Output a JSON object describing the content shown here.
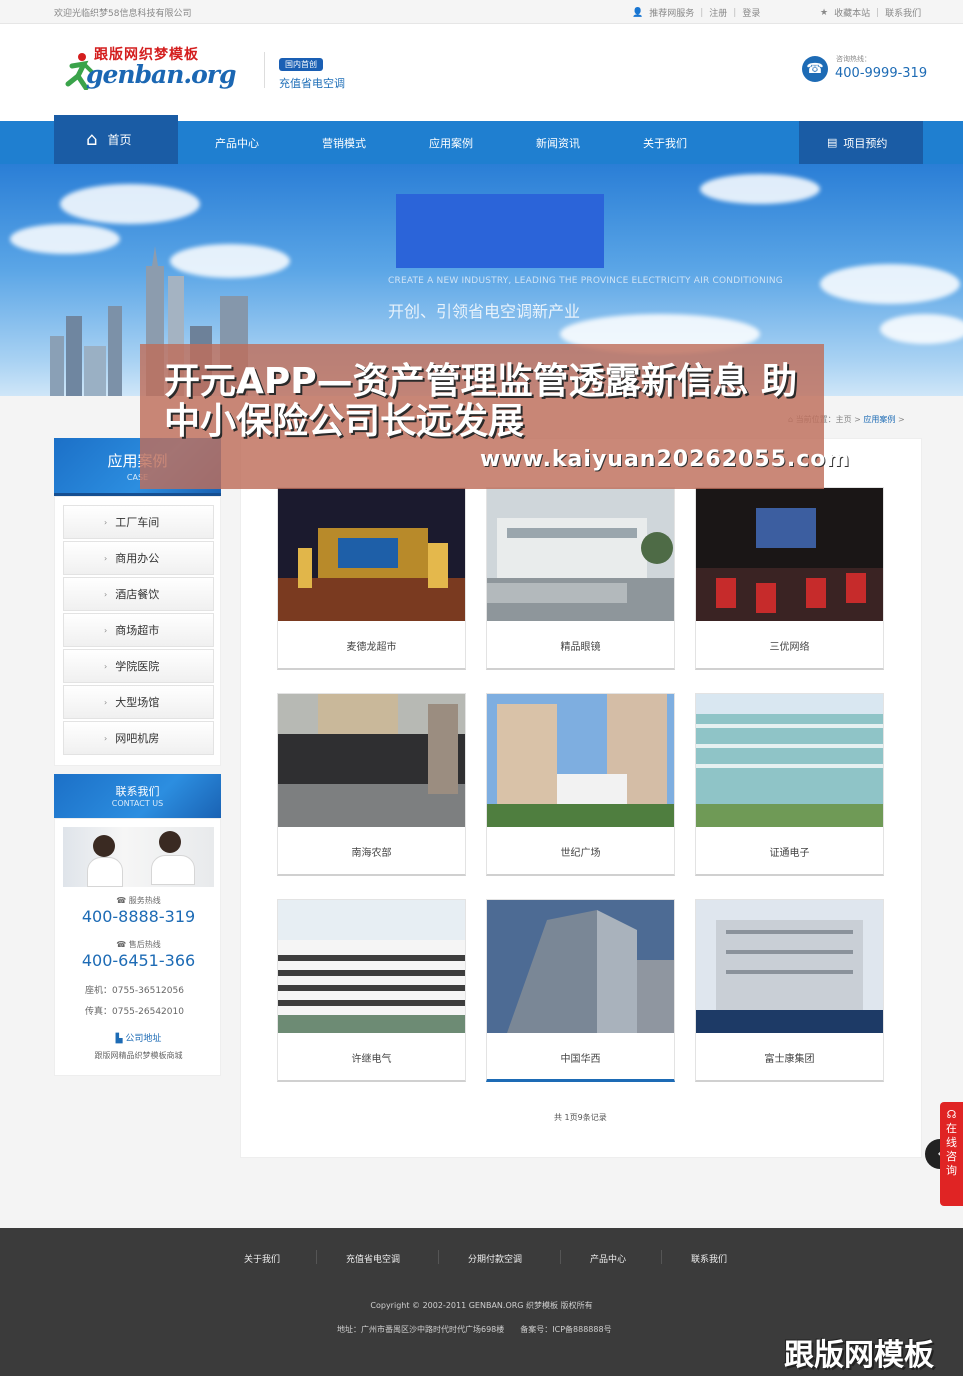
{
  "topbar": {
    "welcome": "欢迎光临织梦58信息科技有限公司",
    "links": [
      "推荐网服务",
      "注册",
      "登录"
    ],
    "right_links": [
      "收藏本站",
      "联系我们"
    ]
  },
  "header": {
    "logo_cn": "跟版网织梦模板",
    "logo_en": "genban.org",
    "badge": "国内首创",
    "slogan": "充值省电空调",
    "hotline_label": "咨询热线：",
    "hotline": "400-9999-319"
  },
  "nav": {
    "home": "首页",
    "items": [
      "产品中心",
      "营销模式",
      "应用案例",
      "新闻资讯",
      "关于我们"
    ],
    "reserve": "项目预约"
  },
  "banner": {
    "en_line": "CREATE A NEW INDUSTRY, LEADING THE PROVINCE ELECTRICITY AIR CONDITIONING",
    "cn_line": "开创、引领省电空调新产业"
  },
  "overlay": {
    "title": "开元APP—资产管理监管透露新信息 助中小保险公司长远发展",
    "url": "www.kaiyuan20262055.com"
  },
  "sidebar": {
    "title": "应用案例",
    "title_en": "CASE",
    "items": [
      "工厂车间",
      "商用办公",
      "酒店餐饮",
      "商场超市",
      "学院医院",
      "大型场馆",
      "网吧机房"
    ]
  },
  "contact": {
    "title": "联系我们",
    "title_en": "CONTACT US",
    "service_label": "服务热线",
    "service_num": "400-8888-319",
    "after_label": "售后热线",
    "after_num": "400-6451-366",
    "mobile": "座机：0755-36512056",
    "fax": "传真：0755-26542010",
    "addr_label": "公司地址",
    "addr": "跟版网精品织梦模板商城"
  },
  "breadcrumb": {
    "prefix": "当前位置：",
    "home": "主页",
    "sep": ">",
    "current": "应用案例",
    "tail": ">"
  },
  "cases": [
    {
      "name": "麦德龙超市"
    },
    {
      "name": "精品眼镜"
    },
    {
      "name": "三优网络"
    },
    {
      "name": "南海农部"
    },
    {
      "name": "世纪广场"
    },
    {
      "name": "证通电子"
    },
    {
      "name": "许继电气"
    },
    {
      "name": "中国华西"
    },
    {
      "name": "富士康集团"
    }
  ],
  "pager": "共 1页9条记录",
  "float": {
    "ask": "在线咨询",
    "back": "‹"
  },
  "footer": {
    "links": [
      "关于我们",
      "充值省电空调",
      "分期付款空调",
      "产品中心",
      "联系我们"
    ],
    "copyright": "Copyright © 2002-2011 GENBAN.ORG 织梦模板 版权所有",
    "address": "地址：广州市番禺区沙中路时代时代广场698楼　　备案号：ICP备888888号"
  },
  "watermark": "跟版网模板",
  "colors": {
    "primary": "#1f7fd0",
    "dark": "#1a5ca5",
    "footer": "#3b3b3b"
  }
}
